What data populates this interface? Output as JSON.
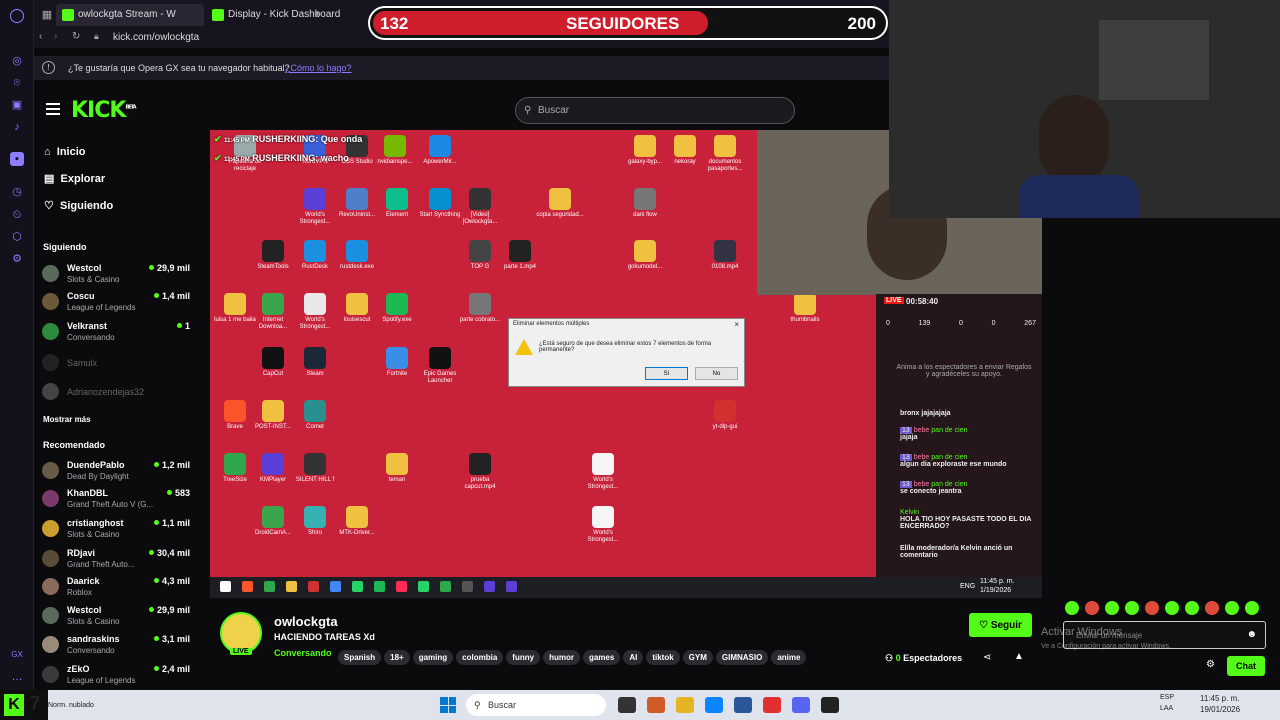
{
  "browser": {
    "tabs": [
      {
        "label": "owlockgta Stream - W",
        "color": "#53fc18"
      },
      {
        "label": "Display - Kick Dashboard",
        "color": "#53fc18"
      }
    ],
    "url": "kick.com/owlockgta",
    "notice_text": "¿Te gustaría que Opera GX sea tu navegador habitual?",
    "notice_link": "¿Cómo lo hago?"
  },
  "followers": {
    "current": "132",
    "label": "SEGUIDORES",
    "goal": "200",
    "fill": 0.66
  },
  "kick": {
    "logo": "KICK",
    "logo_badge": "BETA",
    "search_placeholder": "Buscar",
    "nav": [
      "Inicio",
      "Explorar",
      "Siguiendo"
    ],
    "following_title": "Siguiendo",
    "following": [
      {
        "name": "Westcol",
        "category": "Slots & Casino",
        "viewers": "29,9 mil"
      },
      {
        "name": "Coscu",
        "category": "League of Legends",
        "viewers": "1,4 mil"
      },
      {
        "name": "Velkranst",
        "category": "Conversando",
        "viewers": "1"
      },
      {
        "name": "Samulx",
        "offline": true
      },
      {
        "name": "Adrianozendejas32",
        "offline": true
      }
    ],
    "show_more": "Mostrar más",
    "recommended_title": "Recomendado",
    "recommended": [
      {
        "name": "DuendePablo",
        "category": "Dead By Daylight",
        "viewers": "1,2 mil"
      },
      {
        "name": "KhanDBL",
        "category": "Grand Theft Auto V (G...",
        "viewers": "583"
      },
      {
        "name": "cristianghost",
        "category": "Slots & Casino",
        "viewers": "1,1 mil"
      },
      {
        "name": "RDjavi",
        "category": "Grand Theft Auto...",
        "viewers": "30,4 mil"
      },
      {
        "name": "Daarick",
        "category": "Roblox",
        "viewers": "4,3 mil"
      },
      {
        "name": "Westcol",
        "category": "Slots & Casino",
        "viewers": "29,9 mil"
      },
      {
        "name": "sandraskins",
        "category": "Conversando",
        "viewers": "3,1 mil"
      },
      {
        "name": "zEkO",
        "category": "League of Legends",
        "viewers": "2,4 mil"
      }
    ]
  },
  "stream_overlay": {
    "alert_1": "RUSHERKIING: Que onda",
    "alert_2": "RUSHERKIING: wacho",
    "alert_time": "11:45 PM",
    "desktop_icons": [
      {
        "label": "Papelera de reciclaje",
        "color": "#9aa"
      },
      {
        "label": "NordVPN",
        "color": "#3a5fd9"
      },
      {
        "label": "OBS Studio",
        "color": "#333"
      },
      {
        "label": "nvidiainspe...",
        "color": "#76b900"
      },
      {
        "label": "ApowerMir...",
        "color": "#1e88e5"
      },
      {
        "label": "galaxy-byp...",
        "color": "#f0c040"
      },
      {
        "label": "nekoray",
        "color": "#f0c040"
      },
      {
        "label": "documentos pasaportes...",
        "color": "#f0c040"
      },
      {
        "label": "World's Strongest...",
        "color": "#5b3fd6"
      },
      {
        "label": "RevoUninst...",
        "color": "#4f7fc9"
      },
      {
        "label": "Element",
        "color": "#0dbd8b"
      },
      {
        "label": "Start Syncthing",
        "color": "#0891d1"
      },
      {
        "label": "[Video] [Owlockgta...",
        "color": "#333"
      },
      {
        "label": "copia seguridad...",
        "color": "#f0c040"
      },
      {
        "label": "dani flow",
        "color": "#777"
      },
      {
        "label": "SteamTools",
        "color": "#222"
      },
      {
        "label": "RustDesk",
        "color": "#1b90e0"
      },
      {
        "label": "rustdesk.exe",
        "color": "#1b90e0"
      },
      {
        "label": "TOP G",
        "color": "#444"
      },
      {
        "label": "parte 1.mp4",
        "color": "#222"
      },
      {
        "label": "gokumodel...",
        "color": "#f0c040"
      },
      {
        "label": "0108.mp4",
        "color": "#334"
      },
      {
        "label": "luisa 1 me baila",
        "color": "#f0c040"
      },
      {
        "label": "Internet Downloa...",
        "color": "#3aa54a"
      },
      {
        "label": "World's Strongest...",
        "color": "#e8e8e8"
      },
      {
        "label": "louisescut",
        "color": "#f0c040"
      },
      {
        "label": "Spotify.exe",
        "color": "#1db954"
      },
      {
        "label": "parte cobrato...",
        "color": "#777"
      },
      {
        "label": "thumbnails",
        "color": "#f0c040"
      },
      {
        "label": "CapCut",
        "color": "#111"
      },
      {
        "label": "Steam",
        "color": "#1b2838"
      },
      {
        "label": "Fortnite",
        "color": "#3a8ee6"
      },
      {
        "label": "Epic Games Launcher",
        "color": "#111"
      },
      {
        "label": "Brave",
        "color": "#fb542b"
      },
      {
        "label": "POST-INST...",
        "color": "#f0c040"
      },
      {
        "label": "Comet",
        "color": "#2a8f8f"
      },
      {
        "label": "yt-dlp-gui",
        "color": "#d13030"
      },
      {
        "label": "TreeSize",
        "color": "#2ea84a"
      },
      {
        "label": "KMPlayer",
        "color": "#5b3fd6"
      },
      {
        "label": "SILENT HILL f",
        "color": "#333"
      },
      {
        "label": "teman",
        "color": "#f0c040"
      },
      {
        "label": "prueba capcut.mp4",
        "color": "#222"
      },
      {
        "label": "World's Strongest...",
        "color": "#f5f5f5"
      },
      {
        "label": "DroidCamA...",
        "color": "#3aa54a"
      },
      {
        "label": "Shiro",
        "color": "#36b0b0"
      },
      {
        "label": "MTK-Driver...",
        "color": "#f0c040"
      },
      {
        "label": "World's Strongest...",
        "color": "#f5f5f5"
      }
    ],
    "dialog": {
      "title": "Eliminar elementos múltiples",
      "message": "¿Está seguro de que desea eliminar estos 7 elementos de forma permanente?",
      "yes": "Sí",
      "no": "No"
    },
    "chat": {
      "live_badge": "LIVE",
      "timer": "00:58:40",
      "stats": [
        "0",
        "139",
        "0",
        "0",
        "267"
      ],
      "promo": "Anima a los espectadores a enviar Regalos y agradéceles su apoyo.",
      "messages": [
        {
          "text": "bronx jajajajaja"
        },
        {
          "badge": "13",
          "user": "bebe",
          "target": "pan de cien",
          "text": "jajaja"
        },
        {
          "badge": "13",
          "user": "bebe",
          "target": "pan de cien",
          "text": "algun dia exploraste ese mundo"
        },
        {
          "badge": "13",
          "user": "bebe",
          "target": "pan de cien",
          "text": "se conecto jeantra"
        },
        {
          "user": "Kelvin",
          "text": "HOLA TIO HOY PASASTE TODO EL DIA ENCERRADO?"
        },
        {
          "text": "El/la moderador/a Kelvin anció un comentario"
        }
      ]
    },
    "taskbar": {
      "lang": "ENG",
      "time": "11:45 p. m.",
      "date": "1/19/2026"
    }
  },
  "channel": {
    "name": "owlockgta",
    "title": "HACIENDO TAREAS Xd",
    "category": "Conversando",
    "live_label": "LIVE",
    "tags": [
      "Spanish",
      "18+",
      "gaming",
      "colombia",
      "funny",
      "humor",
      "games",
      "AI",
      "tiktok",
      "GYM",
      "GIMNASIO",
      "anime"
    ],
    "follow_label": "Seguir",
    "viewers_count": "0",
    "viewers_label": "Espectadores",
    "chat_placeholder": "Enviar un mensaje",
    "chat_button": "Chat",
    "watermark_1": "Activar Windows",
    "watermark_2": "Ve a Configuración para activar Windows."
  },
  "windows_taskbar": {
    "search": "Buscar",
    "lang": "ESP",
    "lang2": "LAA",
    "time": "11:45 p. m.",
    "date": "19/01/2026",
    "badge_text": "7",
    "status": "Norm. nublado"
  }
}
